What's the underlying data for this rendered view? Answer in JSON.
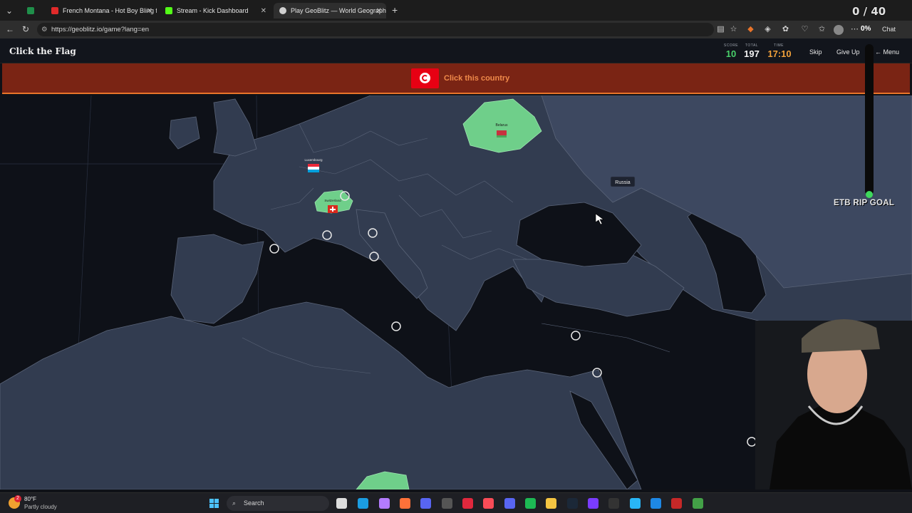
{
  "browser": {
    "tabs": [
      {
        "label": "",
        "color": "#1f8f4a"
      },
      {
        "label": "French Montana - Hot Boy Bling ft",
        "color": "#e02a2a"
      },
      {
        "label": "Stream - Kick Dashboard",
        "color": "#53fc18"
      },
      {
        "label": "Play GeoBlitz — World Geography",
        "color": "#d0d0d0"
      }
    ],
    "url": "https://geoblitz.io/game?lang=en",
    "chat_label": "Chat",
    "zoom_badge": "0%"
  },
  "game": {
    "title": "Click the Flag",
    "score_label": "SCORE",
    "score": "10",
    "total_label": "TOTAL",
    "total": "197",
    "time_label": "TIME",
    "time": "17:10",
    "skip": "Skip",
    "give_up": "Give Up",
    "menu": "← Menu",
    "prompt": "Click this country",
    "accent": "#f08a4a"
  },
  "map": {
    "countries": {
      "belarus": "Belarus",
      "luxembourg": "Luxembourg",
      "switzerland": "Switzerland",
      "russia_tooltip": "Russia"
    }
  },
  "overlay": {
    "counter": "0 / 40",
    "goal": "ETB RIP GOAL"
  },
  "taskbar": {
    "weather_temp": "80°F",
    "weather_desc": "Partly cloudy",
    "weather_badge": "2",
    "search": "Search"
  }
}
